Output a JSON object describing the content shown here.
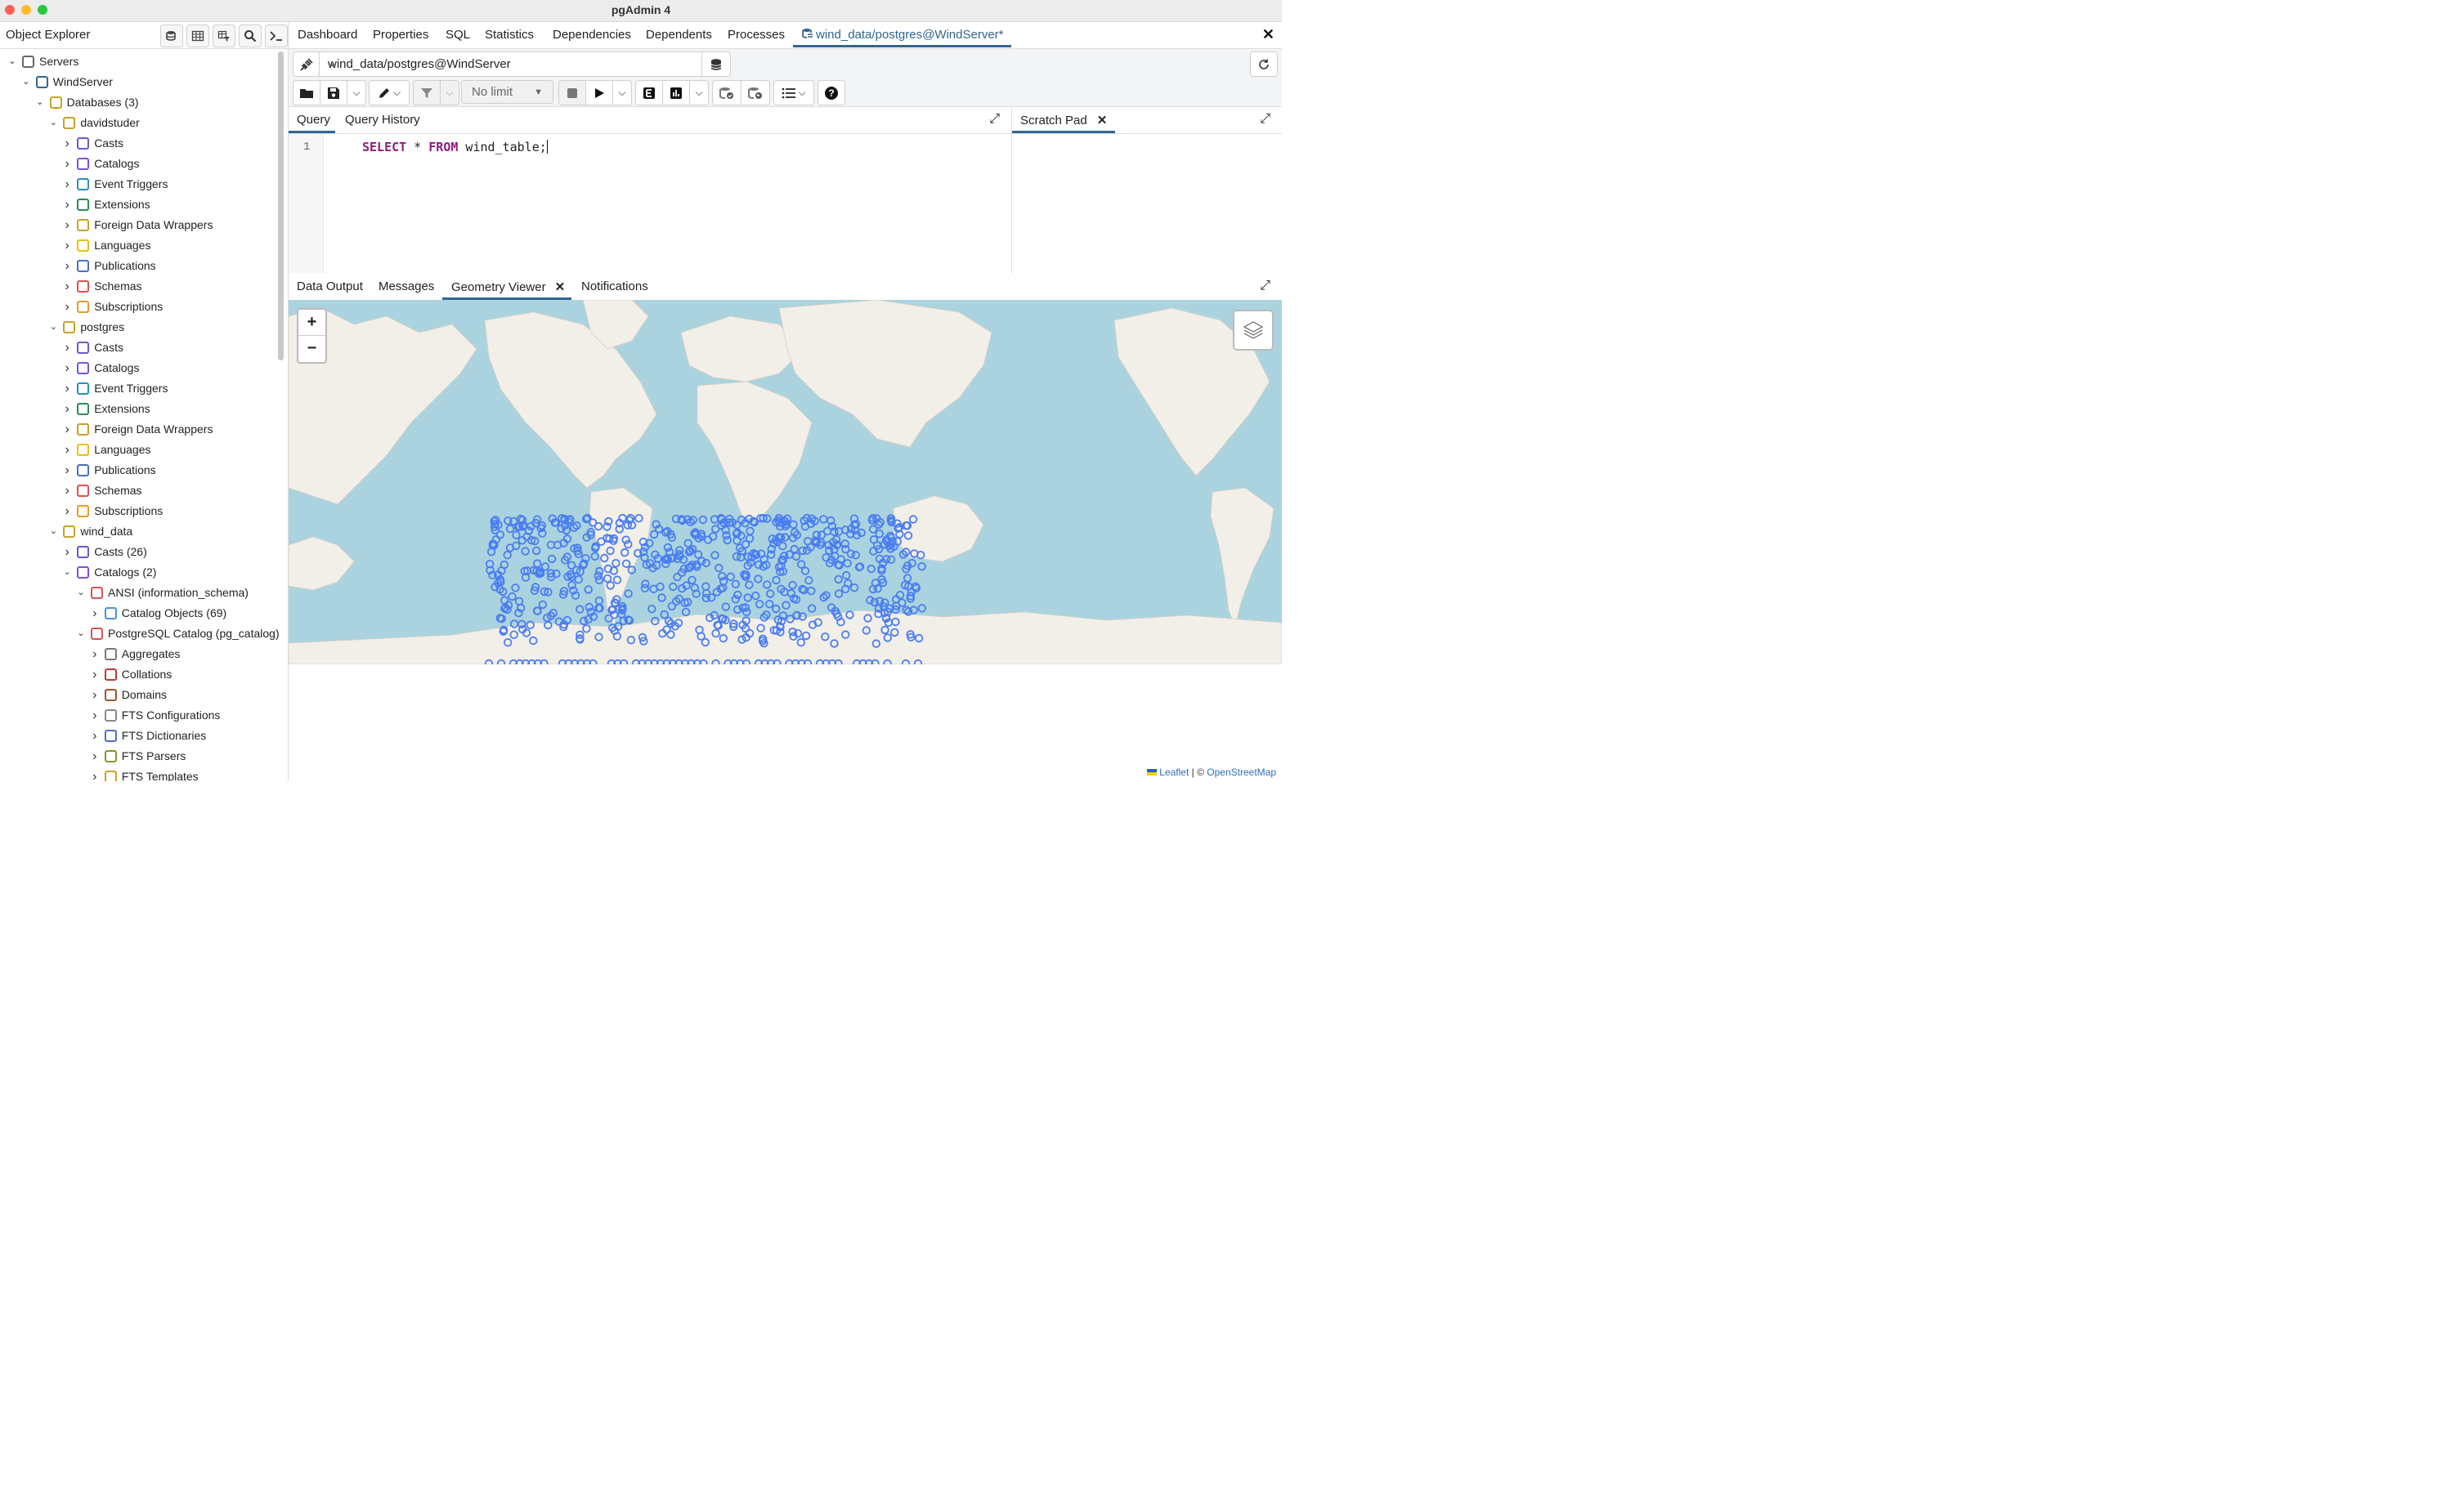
{
  "window": {
    "title": "pgAdmin 4"
  },
  "object_explorer": {
    "title": "Object Explorer",
    "tree": [
      {
        "label": "Servers",
        "depth": 0,
        "expanded": true,
        "icon": "servers-icon"
      },
      {
        "label": "WindServer",
        "depth": 1,
        "expanded": true,
        "icon": "elephant-icon"
      },
      {
        "label": "Databases (3)",
        "depth": 2,
        "expanded": true,
        "icon": "databases-icon"
      },
      {
        "label": "davidstuder",
        "depth": 3,
        "expanded": true,
        "icon": "database-icon"
      },
      {
        "label": "Casts",
        "depth": 4,
        "expanded": false,
        "icon": "casts-icon"
      },
      {
        "label": "Catalogs",
        "depth": 4,
        "expanded": false,
        "icon": "catalogs-icon"
      },
      {
        "label": "Event Triggers",
        "depth": 4,
        "expanded": false,
        "icon": "event-triggers-icon"
      },
      {
        "label": "Extensions",
        "depth": 4,
        "expanded": false,
        "icon": "extensions-icon"
      },
      {
        "label": "Foreign Data Wrappers",
        "depth": 4,
        "expanded": false,
        "icon": "fdw-icon"
      },
      {
        "label": "Languages",
        "depth": 4,
        "expanded": false,
        "icon": "languages-icon"
      },
      {
        "label": "Publications",
        "depth": 4,
        "expanded": false,
        "icon": "publications-icon"
      },
      {
        "label": "Schemas",
        "depth": 4,
        "expanded": false,
        "icon": "schemas-icon"
      },
      {
        "label": "Subscriptions",
        "depth": 4,
        "expanded": false,
        "icon": "subscriptions-icon"
      },
      {
        "label": "postgres",
        "depth": 3,
        "expanded": true,
        "icon": "database-icon"
      },
      {
        "label": "Casts",
        "depth": 4,
        "expanded": false,
        "icon": "casts-icon"
      },
      {
        "label": "Catalogs",
        "depth": 4,
        "expanded": false,
        "icon": "catalogs-icon"
      },
      {
        "label": "Event Triggers",
        "depth": 4,
        "expanded": false,
        "icon": "event-triggers-icon"
      },
      {
        "label": "Extensions",
        "depth": 4,
        "expanded": false,
        "icon": "extensions-icon"
      },
      {
        "label": "Foreign Data Wrappers",
        "depth": 4,
        "expanded": false,
        "icon": "fdw-icon"
      },
      {
        "label": "Languages",
        "depth": 4,
        "expanded": false,
        "icon": "languages-icon"
      },
      {
        "label": "Publications",
        "depth": 4,
        "expanded": false,
        "icon": "publications-icon"
      },
      {
        "label": "Schemas",
        "depth": 4,
        "expanded": false,
        "icon": "schemas-icon"
      },
      {
        "label": "Subscriptions",
        "depth": 4,
        "expanded": false,
        "icon": "subscriptions-icon"
      },
      {
        "label": "wind_data",
        "depth": 3,
        "expanded": true,
        "icon": "database-icon"
      },
      {
        "label": "Casts (26)",
        "depth": 4,
        "expanded": false,
        "icon": "casts-icon"
      },
      {
        "label": "Catalogs (2)",
        "depth": 4,
        "expanded": true,
        "icon": "catalogs-icon"
      },
      {
        "label": "ANSI (information_schema)",
        "depth": 5,
        "expanded": true,
        "icon": "catalog-icon"
      },
      {
        "label": "Catalog Objects (69)",
        "depth": 6,
        "expanded": false,
        "icon": "catalog-objects-icon"
      },
      {
        "label": "PostgreSQL Catalog (pg_catalog)",
        "depth": 5,
        "expanded": true,
        "icon": "catalog-icon"
      },
      {
        "label": "Aggregates",
        "depth": 6,
        "expanded": false,
        "icon": "aggregates-icon"
      },
      {
        "label": "Collations",
        "depth": 6,
        "expanded": false,
        "icon": "collations-icon"
      },
      {
        "label": "Domains",
        "depth": 6,
        "expanded": false,
        "icon": "domains-icon"
      },
      {
        "label": "FTS Configurations",
        "depth": 6,
        "expanded": false,
        "icon": "fts-config-icon"
      },
      {
        "label": "FTS Dictionaries",
        "depth": 6,
        "expanded": false,
        "icon": "fts-dict-icon"
      },
      {
        "label": "FTS Parsers",
        "depth": 6,
        "expanded": false,
        "icon": "fts-parsers-icon"
      },
      {
        "label": "FTS Templates",
        "depth": 6,
        "expanded": false,
        "icon": "fts-templates-icon"
      }
    ]
  },
  "main_tabs": {
    "dashboard": "Dashboard",
    "properties": "Properties",
    "sql": "SQL",
    "statistics": "Statistics",
    "dependencies": "Dependencies",
    "dependents": "Dependents",
    "processes": "Processes",
    "query_tool": "wind_data/postgres@WindServer*"
  },
  "connection": {
    "value": "wind_data/postgres@WindServer"
  },
  "toolbar": {
    "limit": "No limit"
  },
  "query_panel": {
    "tab_query": "Query",
    "tab_history": "Query History",
    "line_number": "1",
    "sql": {
      "kw1": "SELECT",
      "star": " * ",
      "kw2": "FROM",
      "rest": " wind_table;"
    }
  },
  "scratch_pad": {
    "title": "Scratch Pad"
  },
  "results": {
    "tab_data_output": "Data Output",
    "tab_messages": "Messages",
    "tab_geometry_viewer": "Geometry Viewer",
    "tab_notifications": "Notifications"
  },
  "map": {
    "zoom_in": "+",
    "zoom_out": "−",
    "attribution_leaflet": "Leaflet",
    "attribution_sep": " | © ",
    "attribution_osm": "OpenStreetMap",
    "marker_color": "#4a7df0",
    "ocean_color": "#aad3df",
    "land_color": "#f2efe9"
  },
  "colors": {
    "accent": "#326690"
  }
}
